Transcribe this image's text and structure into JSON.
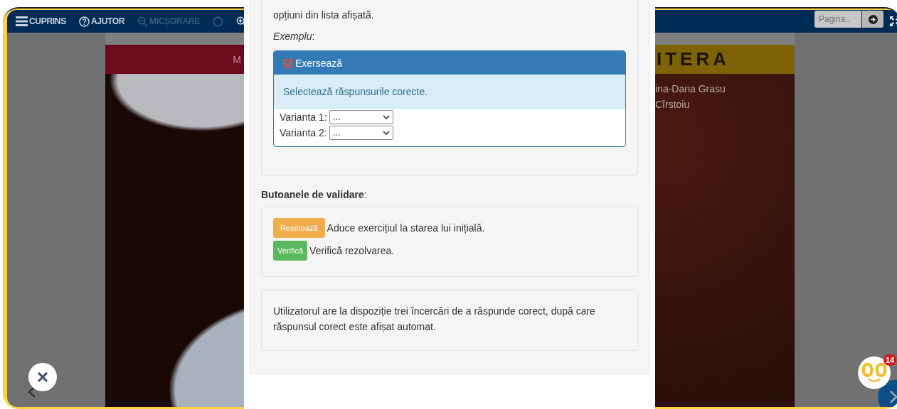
{
  "toolbar": {
    "items": [
      {
        "kind": "labeled",
        "label": "CUPRINS",
        "disabled": false
      },
      {
        "kind": "labeled",
        "label": "AJUTOR",
        "disabled": false
      },
      {
        "kind": "labeled",
        "label": "MICȘORARE",
        "disabled": true
      },
      {
        "kind": "icon",
        "disabled": true
      },
      {
        "kind": "icon",
        "disabled": false
      }
    ],
    "page_field": {
      "placeholder": "Pagina.."
    }
  },
  "book": {
    "title_left": "M",
    "title_right": "ITERA",
    "authors": [
      "ina-Dana Grasu",
      "Cîrstoiu"
    ]
  },
  "modal": {
    "intro": "opțiuni din lista afișată.",
    "example_label": "*Exemplu*:",
    "exercise": {
      "title": "Exersează",
      "checked": true,
      "instruction": "Selectează răspunsurile corecte.",
      "fields": [
        {
          "label": "Varianta 1:",
          "value": "..."
        },
        {
          "label": "Varianta 2:",
          "value": "..."
        }
      ]
    },
    "validation_heading": "**Butoanele de validare**:",
    "buttons": [
      {
        "kind": "reset",
        "label": "Resetează",
        "description": "Aduce exercițiul la starea lui inițială."
      },
      {
        "kind": "verify",
        "label": "Verifică",
        "description": "Verifică rezolvarea."
      }
    ],
    "note": "Utilizatorul are la dispoziție trei încercări de a răspunde corect, după care răspunsul corect este afișat automat."
  },
  "chat": {
    "badge": "14"
  }
}
